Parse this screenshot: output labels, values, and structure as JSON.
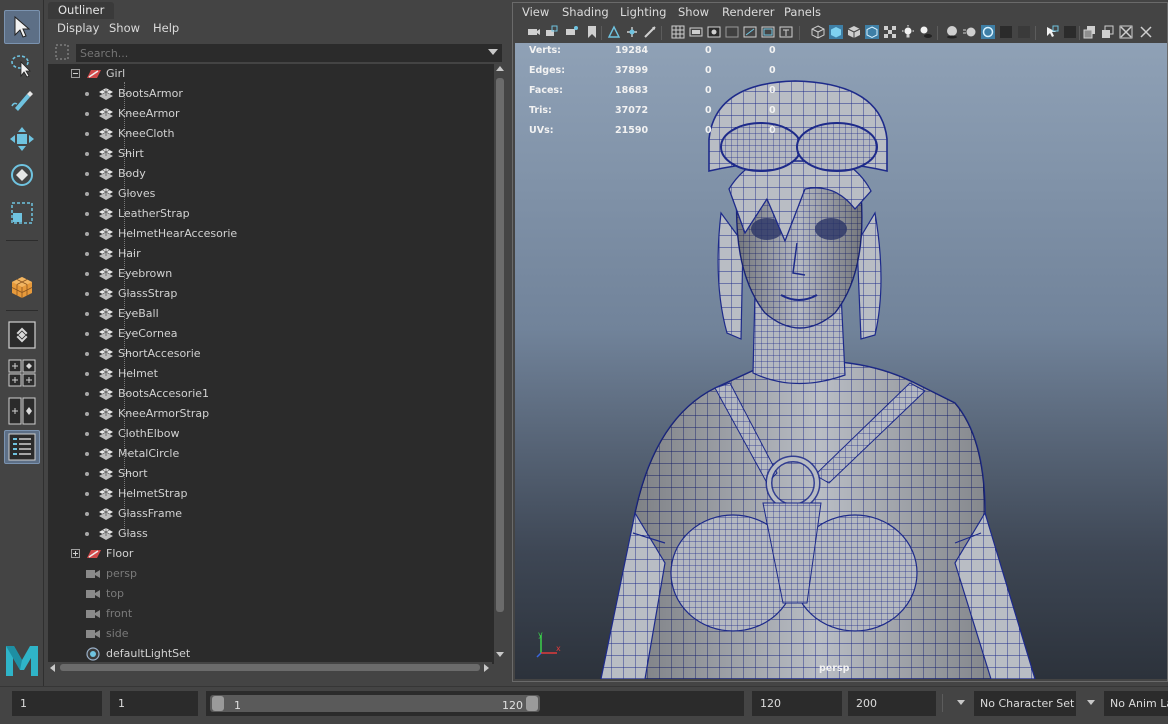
{
  "outliner": {
    "tab_title": "Outliner",
    "menu": [
      "Display",
      "Show",
      "Help"
    ],
    "search_placeholder": "Search...",
    "tree": [
      {
        "label": "Girl",
        "type": "group",
        "expanded": true,
        "depth": 0
      },
      {
        "label": "BootsArmor",
        "type": "mesh",
        "depth": 1
      },
      {
        "label": "KneeArmor",
        "type": "mesh",
        "depth": 1
      },
      {
        "label": "KneeCloth",
        "type": "mesh",
        "depth": 1
      },
      {
        "label": "Shirt",
        "type": "mesh",
        "depth": 1
      },
      {
        "label": "Body",
        "type": "mesh",
        "depth": 1
      },
      {
        "label": "Gloves",
        "type": "mesh",
        "depth": 1
      },
      {
        "label": "LeatherStrap",
        "type": "mesh",
        "depth": 1
      },
      {
        "label": "HelmetHearAccesorie",
        "type": "mesh",
        "depth": 1
      },
      {
        "label": "Hair",
        "type": "mesh",
        "depth": 1
      },
      {
        "label": "Eyebrown",
        "type": "mesh",
        "depth": 1
      },
      {
        "label": "GlassStrap",
        "type": "mesh",
        "depth": 1
      },
      {
        "label": "EyeBall",
        "type": "mesh",
        "depth": 1
      },
      {
        "label": "EyeCornea",
        "type": "mesh",
        "depth": 1
      },
      {
        "label": "ShortAccesorie",
        "type": "mesh",
        "depth": 1
      },
      {
        "label": "Helmet",
        "type": "mesh",
        "depth": 1
      },
      {
        "label": "BootsAccesorie1",
        "type": "mesh",
        "depth": 1
      },
      {
        "label": "KneeArmorStrap",
        "type": "mesh",
        "depth": 1
      },
      {
        "label": "ClothElbow",
        "type": "mesh",
        "depth": 1
      },
      {
        "label": "MetalCircle",
        "type": "mesh",
        "depth": 1
      },
      {
        "label": "Short",
        "type": "mesh",
        "depth": 1
      },
      {
        "label": "HelmetStrap",
        "type": "mesh",
        "depth": 1
      },
      {
        "label": "GlassFrame",
        "type": "mesh",
        "depth": 1
      },
      {
        "label": "Glass",
        "type": "mesh",
        "depth": 1
      },
      {
        "label": "Floor",
        "type": "group",
        "expanded": false,
        "depth": 0
      },
      {
        "label": "persp",
        "type": "camera",
        "depth": 0
      },
      {
        "label": "top",
        "type": "camera",
        "depth": 0
      },
      {
        "label": "front",
        "type": "camera",
        "depth": 0
      },
      {
        "label": "side",
        "type": "camera",
        "depth": 0
      },
      {
        "label": "defaultLightSet",
        "type": "set",
        "depth": 0
      }
    ]
  },
  "viewport": {
    "menu": [
      "View",
      "Shading",
      "Lighting",
      "Show",
      "Renderer",
      "Panels"
    ],
    "hud": [
      {
        "label": "Verts:",
        "v1": "19284",
        "v2": "0",
        "v3": "0"
      },
      {
        "label": "Edges:",
        "v1": "37899",
        "v2": "0",
        "v3": "0"
      },
      {
        "label": "Faces:",
        "v1": "18683",
        "v2": "0",
        "v3": "0"
      },
      {
        "label": "Tris:",
        "v1": "37072",
        "v2": "0",
        "v3": "0"
      },
      {
        "label": "UVs:",
        "v1": "21590",
        "v2": "0",
        "v3": "0"
      }
    ],
    "camera_label": "persp",
    "axis_y": "y",
    "axis_x": "x"
  },
  "timebar": {
    "start_frame": "1",
    "current_start": "1",
    "range_start": "1",
    "range_end": "120",
    "end_frame": "120",
    "anim_end": "200",
    "character_set": "No Character Set",
    "anim_layer": "No Anim La"
  },
  "colors": {
    "accent": "#5d6f86",
    "wire": "#1d2a8a",
    "panel": "#444444",
    "field": "#2b2b2b"
  }
}
